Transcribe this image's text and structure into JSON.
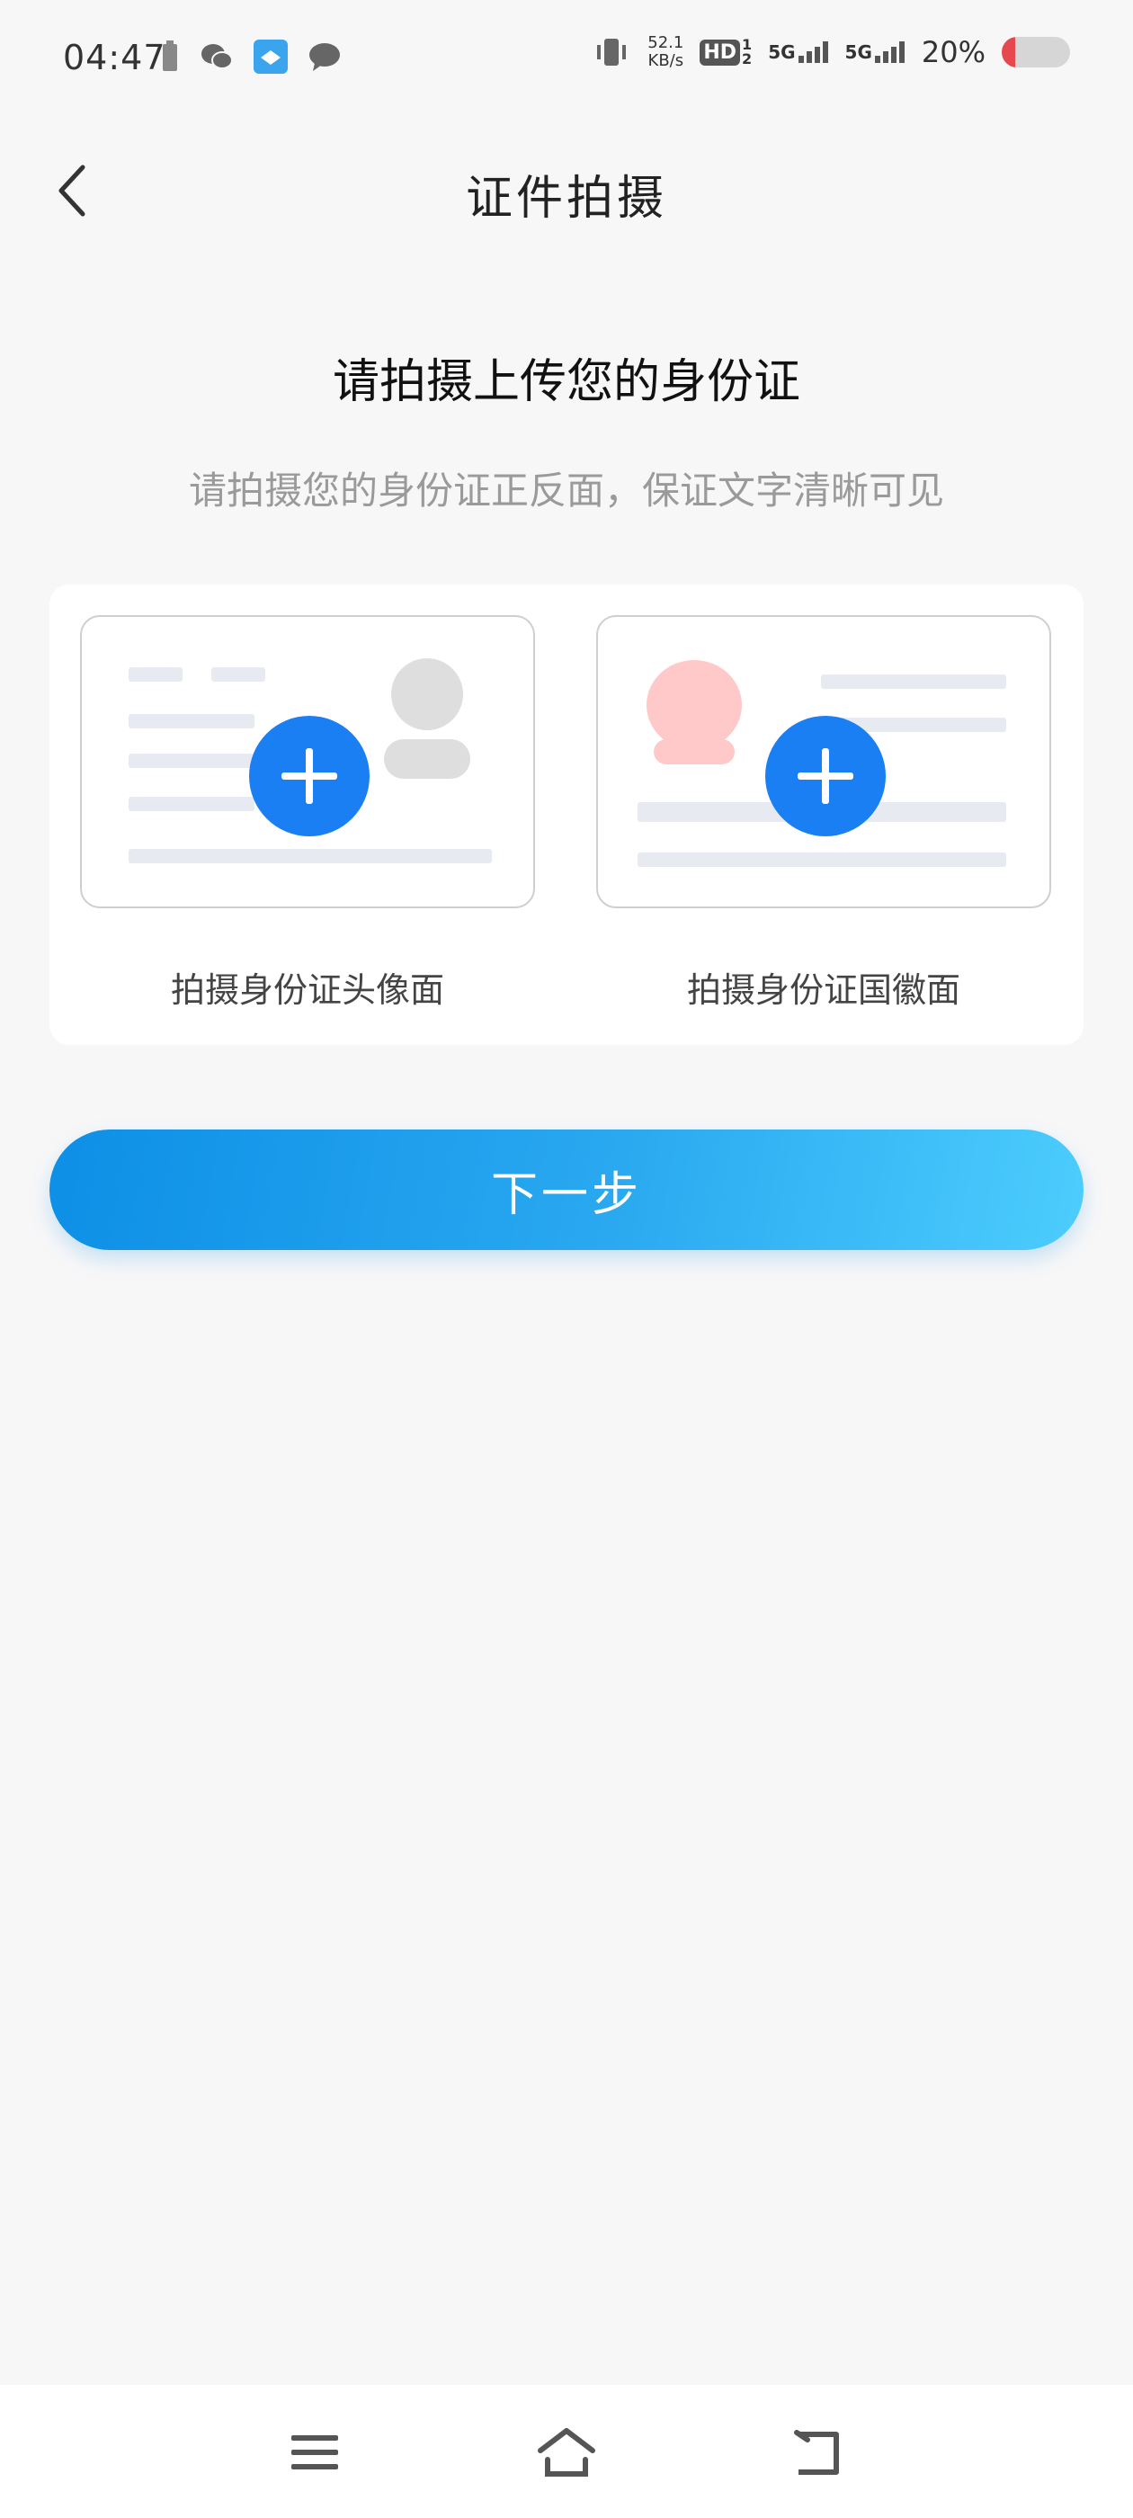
{
  "status_bar": {
    "time": "04:47",
    "net_speed_value": "52.1",
    "net_speed_unit": "KB/s",
    "hd": "HD",
    "hd_sup": "1",
    "hd_sub": "2",
    "signal1": "5G",
    "signal2": "5G",
    "battery": "20%",
    "battery_level": 0.2,
    "battery_color": "#e5484d"
  },
  "header": {
    "title": "证件拍摄"
  },
  "main": {
    "heading": "请拍摄上传您的身份证",
    "subheading": "请拍摄您的身份证正反面，保证文字清晰可见",
    "front_label": "拍摄身份证头像面",
    "back_label": "拍摄身份证国徽面",
    "next_button": "下一步"
  },
  "colors": {
    "accent": "#1a7ff2",
    "button_gradient_start": "#0d8fe6",
    "button_gradient_end": "#4ccdfd",
    "avatar_gray": "#dedede",
    "emblem_pink": "#ffc9c9"
  },
  "icons": {
    "back": "chevron-left-icon",
    "add": "plus-icon",
    "nav_menu": "menu-icon",
    "nav_home": "home-icon",
    "nav_back": "return-icon"
  }
}
